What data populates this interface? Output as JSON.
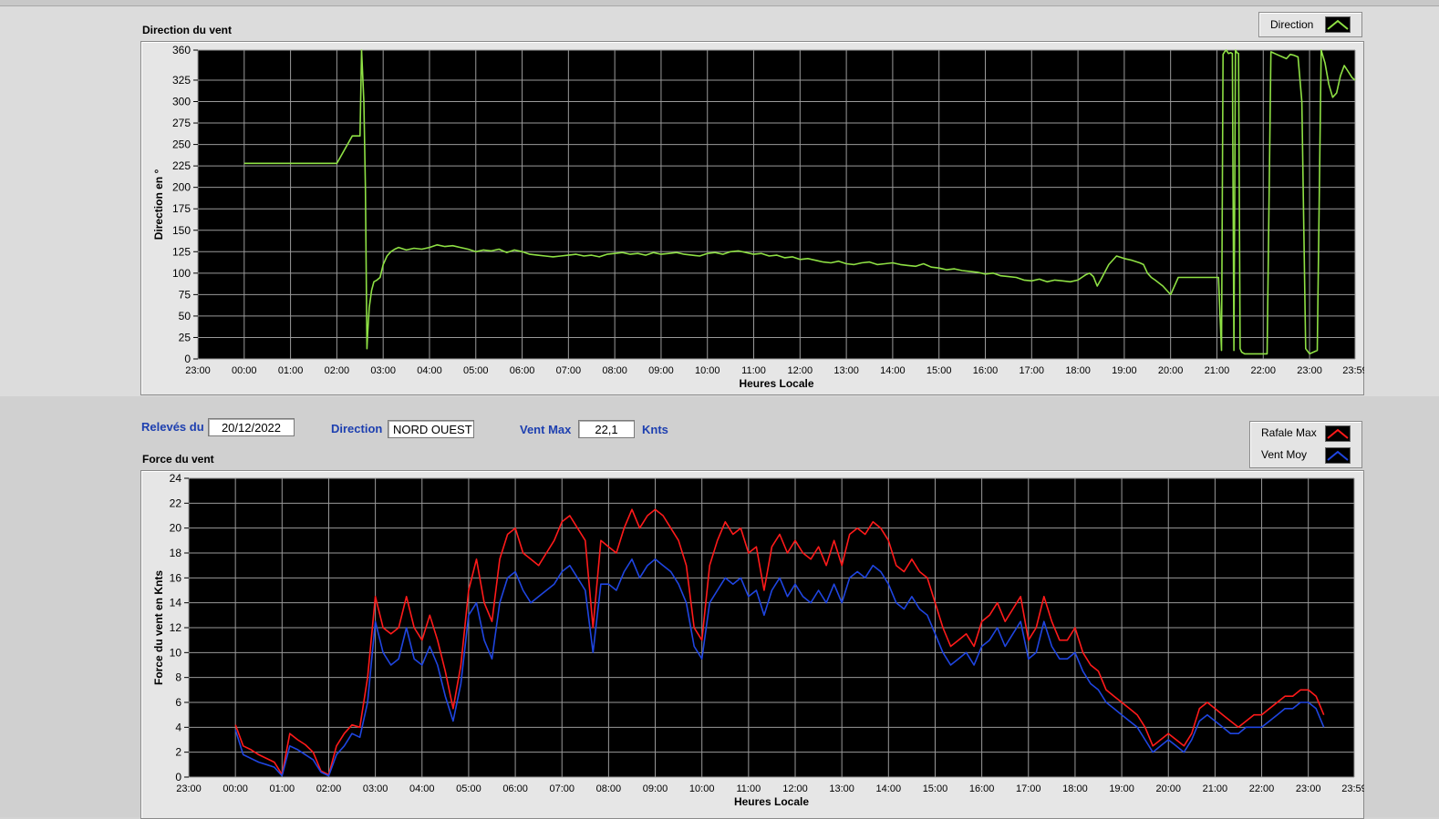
{
  "colors": {
    "direction_line": "#8ee044",
    "gust_line": "#ff1a1a",
    "avg_line": "#1f45e0",
    "plot_bg": "#000000",
    "grid": "#9a9a9a",
    "label_blue": "#1d3fb0"
  },
  "info": {
    "releves_label": "Relevés du",
    "date": "20/12/2022",
    "direction_label": "Direction",
    "direction_value": "NORD OUEST",
    "ventmax_label": "Vent Max",
    "ventmax_value": "22,1",
    "unit": "Knts"
  },
  "direction_chart": {
    "title": "Direction du vent",
    "legend": [
      {
        "name": "Direction",
        "icon": "line-green-icon"
      }
    ],
    "chart_data": {
      "type": "line",
      "title": "Direction du vent",
      "xlabel": "Heures Locale",
      "ylabel": "Direction en °",
      "ylim": [
        0,
        360
      ],
      "yticks": [
        "0",
        "25",
        "50",
        "75",
        "100",
        "125",
        "150",
        "175",
        "200",
        "225",
        "250",
        "275",
        "300",
        "325",
        "360"
      ],
      "ytick_values": [
        0,
        25,
        50,
        75,
        100,
        125,
        150,
        175,
        200,
        225,
        250,
        275,
        300,
        325,
        360
      ],
      "xlim": [
        -60,
        1439
      ],
      "xticks": [
        "23:00",
        "00:00",
        "01:00",
        "02:00",
        "03:00",
        "04:00",
        "05:00",
        "06:00",
        "07:00",
        "08:00",
        "09:00",
        "10:00",
        "11:00",
        "12:00",
        "13:00",
        "14:00",
        "15:00",
        "16:00",
        "17:00",
        "18:00",
        "19:00",
        "20:00",
        "21:00",
        "22:00",
        "23:00",
        "23:59"
      ],
      "xtick_values": [
        -60,
        0,
        60,
        120,
        180,
        240,
        300,
        360,
        420,
        480,
        540,
        600,
        660,
        720,
        780,
        840,
        900,
        960,
        1020,
        1080,
        1140,
        1200,
        1260,
        1320,
        1380,
        1439
      ],
      "grid": true,
      "legend_position": "top-right",
      "series": [
        {
          "name": "Direction",
          "x": [
            0,
            60,
            100,
            120,
            140,
            150,
            152,
            155,
            157,
            158,
            159,
            160,
            162,
            165,
            168,
            172,
            176,
            180,
            185,
            190,
            195,
            200,
            210,
            220,
            230,
            240,
            250,
            260,
            270,
            280,
            290,
            300,
            310,
            320,
            330,
            340,
            350,
            360,
            370,
            380,
            390,
            400,
            410,
            420,
            430,
            440,
            450,
            460,
            470,
            480,
            490,
            500,
            510,
            520,
            530,
            540,
            550,
            560,
            570,
            580,
            590,
            600,
            610,
            620,
            630,
            640,
            650,
            660,
            670,
            680,
            690,
            700,
            710,
            720,
            730,
            740,
            750,
            760,
            770,
            780,
            790,
            800,
            810,
            820,
            830,
            840,
            850,
            860,
            870,
            880,
            890,
            900,
            910,
            920,
            930,
            940,
            950,
            960,
            970,
            980,
            990,
            1000,
            1010,
            1020,
            1030,
            1040,
            1050,
            1060,
            1070,
            1080,
            1085,
            1090,
            1095,
            1100,
            1105,
            1110,
            1120,
            1130,
            1140,
            1150,
            1160,
            1165,
            1170,
            1175,
            1180,
            1190,
            1200,
            1210,
            1220,
            1230,
            1240,
            1250,
            1258,
            1260,
            1262,
            1264,
            1266,
            1268,
            1270,
            1272,
            1275,
            1278,
            1280,
            1282,
            1284,
            1286,
            1288,
            1290,
            1292,
            1294,
            1296,
            1298,
            1300,
            1302,
            1305,
            1310,
            1315,
            1320,
            1325,
            1330,
            1335,
            1340,
            1345,
            1350,
            1355,
            1360,
            1365,
            1370,
            1375,
            1380,
            1385,
            1390,
            1395,
            1400,
            1405,
            1410,
            1415,
            1420,
            1425,
            1430,
            1435,
            1439
          ],
          "y": [
            228,
            228,
            228,
            228,
            260,
            260,
            360,
            300,
            200,
            100,
            12,
            30,
            60,
            80,
            90,
            92,
            95,
            110,
            120,
            125,
            128,
            130,
            127,
            129,
            128,
            130,
            133,
            131,
            132,
            130,
            128,
            125,
            127,
            126,
            128,
            124,
            127,
            125,
            122,
            121,
            120,
            119,
            120,
            121,
            122,
            120,
            121,
            119,
            122,
            123,
            124,
            122,
            123,
            121,
            124,
            122,
            123,
            124,
            122,
            121,
            120,
            123,
            124,
            122,
            125,
            126,
            124,
            122,
            123,
            120,
            121,
            118,
            119,
            116,
            117,
            115,
            113,
            112,
            114,
            111,
            110,
            112,
            113,
            110,
            111,
            112,
            110,
            109,
            108,
            111,
            107,
            106,
            104,
            105,
            103,
            102,
            101,
            99,
            100,
            97,
            96,
            95,
            92,
            91,
            93,
            90,
            92,
            91,
            90,
            92,
            95,
            98,
            100,
            96,
            85,
            93,
            110,
            120,
            117,
            115,
            112,
            110,
            100,
            95,
            92,
            85,
            75,
            95,
            95,
            95,
            95,
            95,
            95,
            95,
            95,
            50,
            10,
            355,
            358,
            360,
            356,
            357,
            356,
            10,
            360,
            357,
            356,
            12,
            8,
            7,
            6,
            6,
            6,
            6,
            6,
            6,
            6,
            6,
            6,
            358,
            356,
            354,
            352,
            350,
            355,
            354,
            352,
            300,
            12,
            6,
            8,
            10,
            360,
            345,
            320,
            305,
            310,
            330,
            342,
            335,
            328,
            325
          ]
        }
      ]
    }
  },
  "force_chart": {
    "title": "Force du vent",
    "legend": [
      {
        "name": "Rafale Max",
        "icon": "line-red-icon"
      },
      {
        "name": "Vent Moy",
        "icon": "line-blue-icon"
      }
    ],
    "chart_data": {
      "type": "line",
      "title": "Force du vent",
      "xlabel": "Heures Locale",
      "ylabel": "Force du vent en Knts",
      "ylim": [
        0,
        24
      ],
      "yticks": [
        "0",
        "2",
        "4",
        "6",
        "8",
        "10",
        "12",
        "14",
        "16",
        "18",
        "20",
        "22",
        "24"
      ],
      "ytick_values": [
        0,
        2,
        4,
        6,
        8,
        10,
        12,
        14,
        16,
        18,
        20,
        22,
        24
      ],
      "xlim": [
        -60,
        1439
      ],
      "xticks": [
        "23:00",
        "00:00",
        "01:00",
        "02:00",
        "03:00",
        "04:00",
        "05:00",
        "06:00",
        "07:00",
        "08:00",
        "09:00",
        "10:00",
        "11:00",
        "12:00",
        "13:00",
        "14:00",
        "15:00",
        "16:00",
        "17:00",
        "18:00",
        "19:00",
        "20:00",
        "21:00",
        "22:00",
        "23:00",
        "23:59"
      ],
      "xtick_values": [
        -60,
        0,
        60,
        120,
        180,
        240,
        300,
        360,
        420,
        480,
        540,
        600,
        660,
        720,
        780,
        840,
        900,
        960,
        1020,
        1080,
        1140,
        1200,
        1260,
        1320,
        1380,
        1439
      ],
      "grid": true,
      "legend_position": "top-right",
      "x": [
        0,
        10,
        20,
        30,
        40,
        50,
        60,
        70,
        80,
        90,
        100,
        110,
        120,
        130,
        140,
        150,
        160,
        170,
        180,
        190,
        200,
        210,
        220,
        230,
        240,
        250,
        260,
        270,
        280,
        290,
        300,
        310,
        320,
        330,
        340,
        350,
        360,
        370,
        380,
        390,
        400,
        410,
        420,
        430,
        440,
        450,
        460,
        470,
        480,
        490,
        500,
        510,
        520,
        530,
        540,
        550,
        560,
        570,
        580,
        590,
        600,
        610,
        620,
        630,
        640,
        650,
        660,
        670,
        680,
        690,
        700,
        710,
        720,
        730,
        740,
        750,
        760,
        770,
        780,
        790,
        800,
        810,
        820,
        830,
        840,
        850,
        860,
        870,
        880,
        890,
        900,
        910,
        920,
        930,
        940,
        950,
        960,
        970,
        980,
        990,
        1000,
        1010,
        1020,
        1030,
        1040,
        1050,
        1060,
        1070,
        1080,
        1090,
        1100,
        1110,
        1120,
        1130,
        1140,
        1150,
        1160,
        1170,
        1180,
        1190,
        1200,
        1210,
        1220,
        1230,
        1240,
        1250,
        1260,
        1270,
        1280,
        1290,
        1300,
        1310,
        1320,
        1330,
        1340,
        1350,
        1360,
        1370,
        1380,
        1390,
        1400,
        1410,
        1420,
        1430,
        1439
      ],
      "series": [
        {
          "name": "Rafale Max",
          "values": [
            4.2,
            2.5,
            2.2,
            1.8,
            1.5,
            1.2,
            0.2,
            3.5,
            3.0,
            2.6,
            2.0,
            0.5,
            0.2,
            2.5,
            3.5,
            4.2,
            4.0,
            8.0,
            14.5,
            12.0,
            11.5,
            12.0,
            14.5,
            12.0,
            11.0,
            13.0,
            11.0,
            8.5,
            5.5,
            9.0,
            15.0,
            17.5,
            14.0,
            12.5,
            17.5,
            19.5,
            20.0,
            18.0,
            17.5,
            17.0,
            18.0,
            19.0,
            20.5,
            21.0,
            20.0,
            19.0,
            12.0,
            19.0,
            18.5,
            18.0,
            20.0,
            21.5,
            20.0,
            21.0,
            21.5,
            21.0,
            20.0,
            19.0,
            17.0,
            12.0,
            11.0,
            17.0,
            19.0,
            20.5,
            19.5,
            20.0,
            18.0,
            18.5,
            15.0,
            18.5,
            19.5,
            18.0,
            19.0,
            18.0,
            17.5,
            18.5,
            17.0,
            19.0,
            17.0,
            19.5,
            20.0,
            19.5,
            20.5,
            20.0,
            19.0,
            17.0,
            16.5,
            17.5,
            16.5,
            16.0,
            14.0,
            12.0,
            10.5,
            11.0,
            11.5,
            10.5,
            12.5,
            13.0,
            14.0,
            12.5,
            13.5,
            14.5,
            11.0,
            12.0,
            14.5,
            12.5,
            11.0,
            11.0,
            12.0,
            10.0,
            9.0,
            8.5,
            7.0,
            6.5,
            6.0,
            5.5,
            5.0,
            4.0,
            2.5,
            3.0,
            3.5,
            3.0,
            2.5,
            3.5,
            5.5,
            6.0,
            5.5,
            5.0,
            4.5,
            4.0,
            4.5,
            5.0,
            5.0,
            5.5,
            6.0,
            6.5,
            6.5,
            7.0,
            7.0,
            6.5,
            5.0
          ]
        },
        {
          "name": "Vent Moy",
          "values": [
            3.8,
            1.8,
            1.5,
            1.2,
            1.0,
            0.8,
            0.1,
            2.5,
            2.2,
            1.8,
            1.4,
            0.4,
            0.1,
            1.8,
            2.5,
            3.5,
            3.2,
            6.0,
            12.5,
            10.0,
            9.0,
            9.5,
            12.0,
            9.5,
            9.0,
            10.5,
            9.0,
            6.5,
            4.5,
            7.5,
            13.0,
            14.0,
            11.0,
            9.5,
            14.0,
            16.0,
            16.5,
            15.0,
            14.0,
            14.5,
            15.0,
            15.5,
            16.5,
            17.0,
            16.0,
            15.0,
            10.0,
            15.5,
            15.5,
            15.0,
            16.5,
            17.5,
            16.0,
            17.0,
            17.5,
            17.0,
            16.5,
            15.5,
            14.0,
            10.5,
            9.5,
            14.0,
            15.0,
            16.0,
            15.5,
            16.0,
            14.5,
            15.0,
            13.0,
            15.0,
            16.0,
            14.5,
            15.5,
            14.5,
            14.0,
            15.0,
            14.0,
            15.5,
            14.0,
            16.0,
            16.5,
            16.0,
            17.0,
            16.5,
            15.5,
            14.0,
            13.5,
            14.5,
            13.5,
            13.0,
            11.5,
            10.0,
            9.0,
            9.5,
            10.0,
            9.0,
            10.5,
            11.0,
            12.0,
            10.5,
            11.5,
            12.5,
            9.5,
            10.0,
            12.5,
            10.5,
            9.5,
            9.5,
            10.0,
            8.5,
            7.5,
            7.0,
            6.0,
            5.5,
            5.0,
            4.5,
            4.0,
            3.0,
            2.0,
            2.5,
            3.0,
            2.5,
            2.0,
            3.0,
            4.5,
            5.0,
            4.5,
            4.0,
            3.5,
            3.5,
            4.0,
            4.0,
            4.0,
            4.5,
            5.0,
            5.5,
            5.5,
            6.0,
            6.0,
            5.5,
            4.0
          ]
        }
      ]
    }
  }
}
